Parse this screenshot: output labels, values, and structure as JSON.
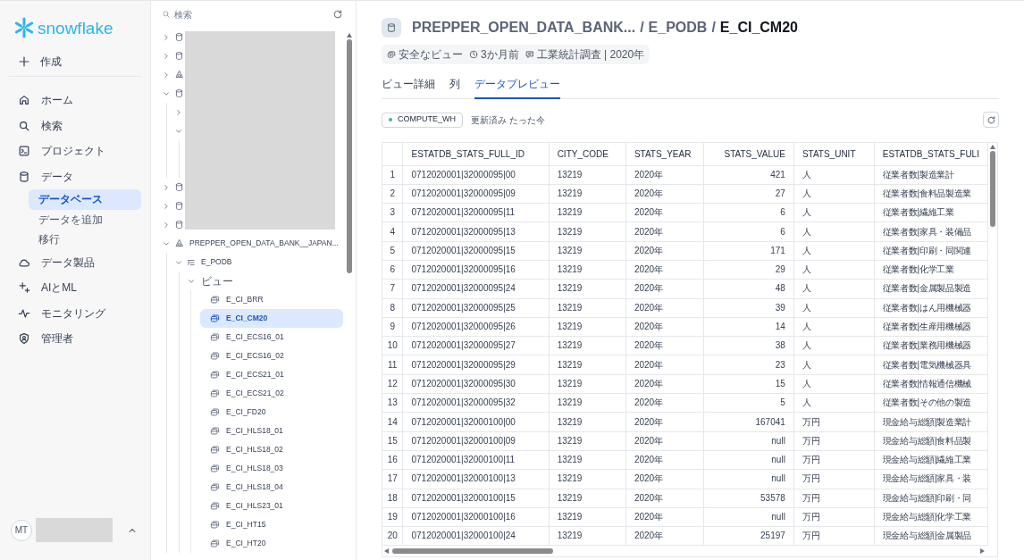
{
  "logo": {
    "text": "snowflake"
  },
  "create": {
    "label": "作成"
  },
  "nav": [
    {
      "kind": "home",
      "label": "ホーム"
    },
    {
      "kind": "search",
      "label": "検索"
    },
    {
      "kind": "project",
      "label": "プロジェクト"
    },
    {
      "kind": "data",
      "label": "データ",
      "children": [
        {
          "label": "データベース",
          "selected": true
        },
        {
          "label": "データを追加",
          "selected": false
        },
        {
          "label": "移行",
          "selected": false
        }
      ]
    },
    {
      "kind": "cloud",
      "label": "データ製品"
    },
    {
      "kind": "sparkle",
      "label": "AIとML"
    },
    {
      "kind": "pulse",
      "label": "モニタリング"
    },
    {
      "kind": "shield",
      "label": "管理者"
    }
  ],
  "user": {
    "initials": "MT"
  },
  "tree_search": {
    "placeholder": "検索"
  },
  "hidden_nodes": [
    {
      "kind": "database",
      "expanded": false
    },
    {
      "kind": "database",
      "expanded": false
    },
    {
      "kind": "share",
      "expanded": false
    },
    {
      "kind": "database",
      "expanded": true,
      "children": [
        {
          "expanded": false
        },
        {
          "expanded": true
        }
      ]
    },
    {
      "kind": "database",
      "expanded": false
    },
    {
      "kind": "database",
      "expanded": false
    },
    {
      "kind": "database",
      "expanded": false
    }
  ],
  "tree": {
    "label": "PREPPER_OPEN_DATA_BANK__JAPAN...",
    "expanded": true,
    "schema": {
      "label": "E_PODB",
      "expanded": true,
      "folder": {
        "label": "ビュー",
        "expanded": true,
        "views": [
          {
            "label": "E_CI_BRR",
            "selected": false
          },
          {
            "label": "E_CI_CM20",
            "selected": true
          },
          {
            "label": "E_CI_ECS16_01",
            "selected": false
          },
          {
            "label": "E_CI_ECS16_02",
            "selected": false
          },
          {
            "label": "E_CI_ECS21_01",
            "selected": false
          },
          {
            "label": "E_CI_ECS21_02",
            "selected": false
          },
          {
            "label": "E_CI_FD20",
            "selected": false
          },
          {
            "label": "E_CI_HLS18_01",
            "selected": false
          },
          {
            "label": "E_CI_HLS18_02",
            "selected": false
          },
          {
            "label": "E_CI_HLS18_03",
            "selected": false
          },
          {
            "label": "E_CI_HLS18_04",
            "selected": false
          },
          {
            "label": "E_CI_HLS23_01",
            "selected": false
          },
          {
            "label": "E_CI_HT15",
            "selected": false
          },
          {
            "label": "E_CI_HT20",
            "selected": false
          }
        ]
      }
    }
  },
  "breadcrumb": [
    "PREPPER_OPEN_DATA_BANK...",
    "/",
    "E_PODB",
    "/",
    "E_CI_CM20"
  ],
  "meta": [
    {
      "kind": "secure",
      "label": "安全なビュー"
    },
    {
      "kind": "clock",
      "label": "3か月前"
    },
    {
      "kind": "comment",
      "label": "工業統計調査 | 2020年"
    }
  ],
  "tabs": [
    {
      "label": "ビュー詳細",
      "selected": false
    },
    {
      "label": "列",
      "selected": false
    },
    {
      "label": "データプレビュー",
      "selected": true
    }
  ],
  "warehouse": {
    "label": "COMPUTE_WH",
    "color": "#3fb68b"
  },
  "updated": "更新済み たった今",
  "table": {
    "columns": [
      {
        "kind": "index"
      },
      {
        "label": "ESTATDB_STATS_FULL_ID",
        "kind": "text"
      },
      {
        "label": "CITY_CODE",
        "kind": "text"
      },
      {
        "label": "STATS_YEAR",
        "kind": "text"
      },
      {
        "label": "STATS_VALUE",
        "kind": "number"
      },
      {
        "label": "STATS_UNIT",
        "kind": "text"
      },
      {
        "label": "ESTATDB_STATS_FULI",
        "kind": "text"
      }
    ],
    "rows": [
      [
        "1",
        "0712020001|32000095|00",
        "13219",
        "2020年",
        "421",
        "人",
        "従業者数|製造業計"
      ],
      [
        "2",
        "0712020001|32000095|09",
        "13219",
        "2020年",
        "27",
        "人",
        "従業者数|食料品製造業"
      ],
      [
        "3",
        "0712020001|32000095|11",
        "13219",
        "2020年",
        "6",
        "人",
        "従業者数|繊維工業"
      ],
      [
        "4",
        "0712020001|32000095|13",
        "13219",
        "2020年",
        "6",
        "人",
        "従業者数|家具・装備品"
      ],
      [
        "5",
        "0712020001|32000095|15",
        "13219",
        "2020年",
        "171",
        "人",
        "従業者数|印刷・同関連"
      ],
      [
        "6",
        "0712020001|32000095|16",
        "13219",
        "2020年",
        "29",
        "人",
        "従業者数|化学工業"
      ],
      [
        "7",
        "0712020001|32000095|24",
        "13219",
        "2020年",
        "48",
        "人",
        "従業者数|金属製品製造"
      ],
      [
        "8",
        "0712020001|32000095|25",
        "13219",
        "2020年",
        "39",
        "人",
        "従業者数|はん用機械器"
      ],
      [
        "9",
        "0712020001|32000095|26",
        "13219",
        "2020年",
        "14",
        "人",
        "従業者数|生産用機械器"
      ],
      [
        "10",
        "0712020001|32000095|27",
        "13219",
        "2020年",
        "38",
        "人",
        "従業者数|業務用機械器"
      ],
      [
        "11",
        "0712020001|32000095|29",
        "13219",
        "2020年",
        "23",
        "人",
        "従業者数|電気機械器具"
      ],
      [
        "12",
        "0712020001|32000095|30",
        "13219",
        "2020年",
        "15",
        "人",
        "従業者数|情報通信機械"
      ],
      [
        "13",
        "0712020001|32000095|32",
        "13219",
        "2020年",
        "5",
        "人",
        "従業者数|その他の製造"
      ],
      [
        "14",
        "0712020001|32000100|00",
        "13219",
        "2020年",
        "167041",
        "万円",
        "現金給与総額|製造業計"
      ],
      [
        "15",
        "0712020001|32000100|09",
        "13219",
        "2020年",
        "null",
        "万円",
        "現金給与総額|食料品製"
      ],
      [
        "16",
        "0712020001|32000100|11",
        "13219",
        "2020年",
        "null",
        "万円",
        "現金給与総額|繊維工業"
      ],
      [
        "17",
        "0712020001|32000100|13",
        "13219",
        "2020年",
        "null",
        "万円",
        "現金給与総額|家具・装"
      ],
      [
        "18",
        "0712020001|32000100|15",
        "13219",
        "2020年",
        "53578",
        "万円",
        "現金給与総額|印刷・同"
      ],
      [
        "19",
        "0712020001|32000100|16",
        "13219",
        "2020年",
        "null",
        "万円",
        "現金給与総額|化学工業"
      ],
      [
        "20",
        "0712020001|32000100|24",
        "13219",
        "2020年",
        "25197",
        "万円",
        "現金給与総額|金属製品"
      ]
    ]
  }
}
